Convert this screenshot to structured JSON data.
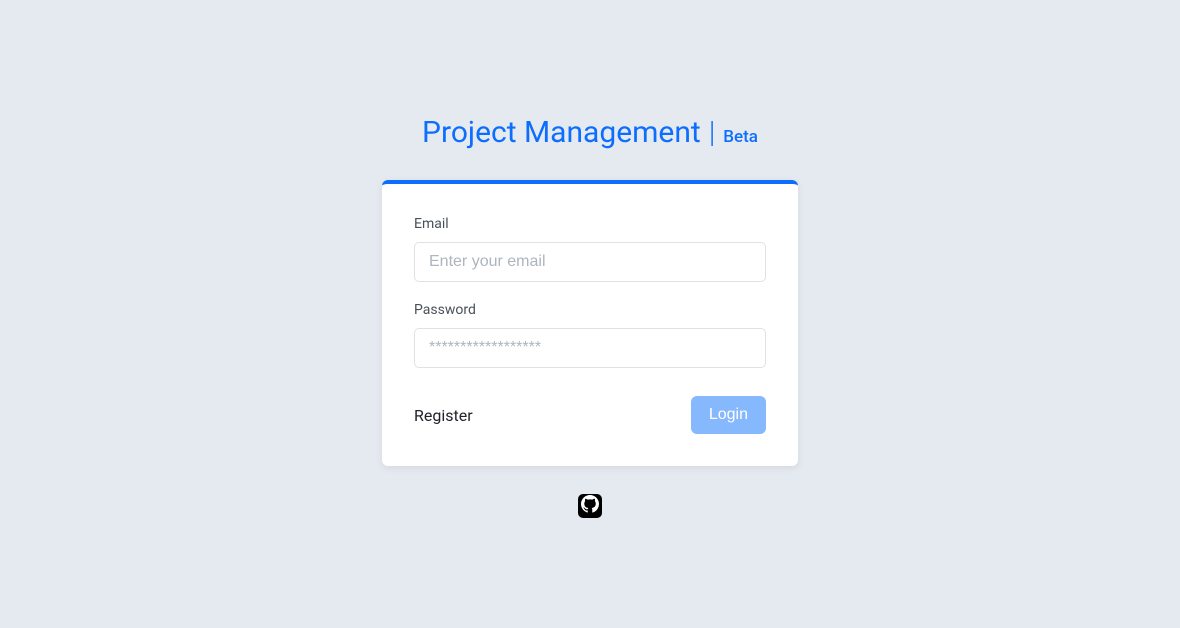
{
  "header": {
    "title": "Project Management",
    "separator": "|",
    "badge": "Beta"
  },
  "form": {
    "email": {
      "label": "Email",
      "placeholder": "Enter your email",
      "value": ""
    },
    "password": {
      "label": "Password",
      "placeholder": "******************",
      "value": ""
    },
    "register_label": "Register",
    "login_label": "Login"
  },
  "colors": {
    "primary": "#0d6efd",
    "background": "#e5eaf0",
    "button": "#85b8fd"
  }
}
